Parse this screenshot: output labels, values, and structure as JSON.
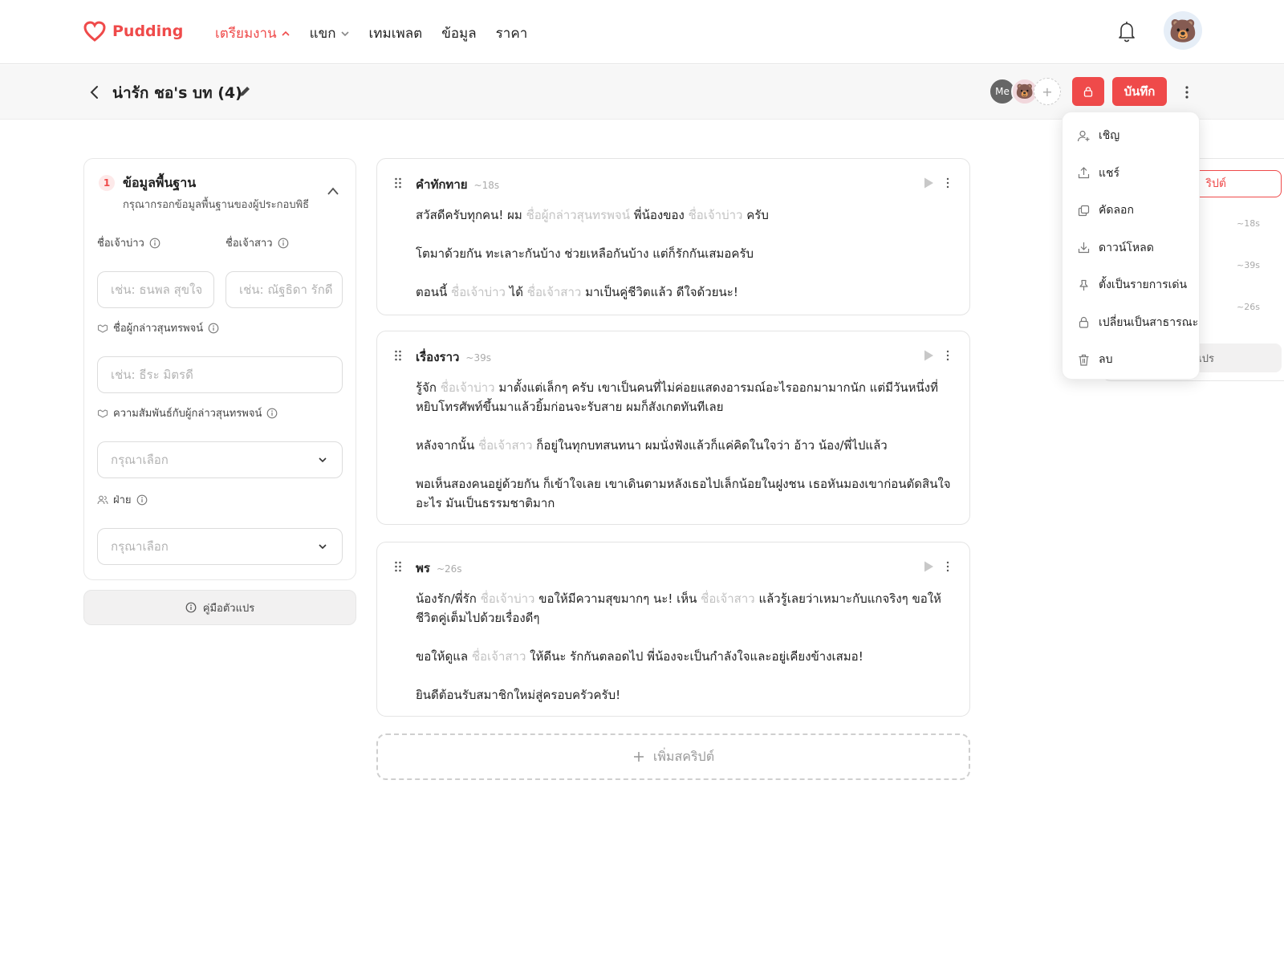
{
  "brand": {
    "name": "Pudding",
    "color": "#ef4a4a"
  },
  "nav": {
    "items": [
      {
        "label": "เตรียมงาน",
        "active": true,
        "caret": "up"
      },
      {
        "label": "แขก",
        "active": false,
        "caret": "down"
      },
      {
        "label": "เทมเพลต",
        "active": false,
        "caret": ""
      },
      {
        "label": "ข้อมูล",
        "active": false,
        "caret": ""
      },
      {
        "label": "ราคา",
        "active": false,
        "caret": ""
      }
    ],
    "icons": {
      "bell": "bell-icon",
      "avatar": "bear-avatar"
    }
  },
  "subheader": {
    "title": "น่ารัก ชอ's บท (4)",
    "collaborators": [
      {
        "label": "Me"
      },
      {
        "label": "🐻"
      },
      {
        "label": "+"
      }
    ],
    "save_label": "บันทึก"
  },
  "basic_info": {
    "step": "1",
    "title": "ข้อมูลพื้นฐาน",
    "subtitle": "กรุณากรอกข้อมูลพื้นฐานของผู้ประกอบพิธี",
    "groom_label": "ชื่อเจ้าบ่าว",
    "bride_label": "ชื่อเจ้าสาว",
    "groom_placeholder": "เช่น: ธนพล สุขใจ",
    "bride_placeholder": "เช่น: ณัฐธิดา รักดี",
    "speaker_label": "ชื่อผู้กล่าวสุนทรพจน์",
    "speaker_placeholder": "เช่น: ธีระ มิตรดี",
    "relation_label": "ความสัมพันธ์กับผู้กล่าวสุนทรพจน์",
    "relation_value": "กรุณาเลือก",
    "side_label": "ฝ่าย",
    "side_value": "กรุณาเลือก",
    "guide_label": "คู่มือตัวแปร"
  },
  "scripts": [
    {
      "title": "คำทักทาย",
      "duration": "~18s",
      "paragraphs": [
        [
          "สวัสดีครับทุกคน! ผม ",
          {
            "ph": "ชื่อผู้กล่าวสุนทรพจน์"
          },
          " พี่น้องของ ",
          {
            "ph": "ชื่อเจ้าบ่าว"
          },
          " ครับ"
        ],
        [
          "โตมาด้วยกัน ทะเลาะกันบ้าง ช่วยเหลือกันบ้าง แต่ก็รักกันเสมอครับ"
        ],
        [
          "ตอนนี้ ",
          {
            "ph": "ชื่อเจ้าบ่าว"
          },
          " ได้ ",
          {
            "ph": "ชื่อเจ้าสาว"
          },
          " มาเป็นคู่ชีวิตแล้ว ดีใจด้วยนะ!"
        ]
      ]
    },
    {
      "title": "เรื่องราว",
      "duration": "~39s",
      "paragraphs": [
        [
          "รู้จัก ",
          {
            "ph": "ชื่อเจ้าบ่าว"
          },
          " มาตั้งแต่เล็กๆ ครับ เขาเป็นคนที่ไม่ค่อยแสดงอารมณ์อะไรออกมามากนัก แต่มีวันหนึ่งที่หยิบโทรศัพท์ขึ้นมาแล้วยิ้มก่อนจะรับสาย ผมก็สังเกตทันทีเลย"
        ],
        [
          "หลังจากนั้น ",
          {
            "ph": "ชื่อเจ้าสาว"
          },
          " ก็อยู่ในทุกบทสนทนา ผมนั่งฟังแล้วก็แค่คิดในใจว่า อ้าว น้อง/พี่ไปแล้ว"
        ],
        [
          "พอเห็นสองคนอยู่ด้วยกัน ก็เข้าใจเลย เขาเดินตามหลังเธอไปเล็กน้อยในฝูงชน เธอหันมองเขาก่อนตัดสินใจอะไร มันเป็นธรรมชาติมาก"
        ]
      ]
    },
    {
      "title": "พร",
      "duration": "~26s",
      "paragraphs": [
        [
          "น้องรัก/พี่รัก ",
          {
            "ph": "ชื่อเจ้าบ่าว"
          },
          " ขอให้มีความสุขมากๆ นะ! เห็น ",
          {
            "ph": "ชื่อเจ้าสาว"
          },
          " แล้วรู้เลยว่าเหมาะกับแกจริงๆ ขอให้ชีวิตคู่เต็มไปด้วยเรื่องดีๆ"
        ],
        [
          "ขอให้ดูแล ",
          {
            "ph": "ชื่อเจ้าสาว"
          },
          " ให้ดีนะ รักกันตลอดไป พี่น้องจะเป็นกำลังใจและอยู่เคียงข้างเสมอ!"
        ],
        [
          "ยินดีต้อนรับสมาชิกใหม่สู่ครอบครัวครับ!"
        ]
      ]
    }
  ],
  "add_script_label": "เพิ่มสคริปต์",
  "right_panel": {
    "button_label": "ริปต์",
    "durations": [
      "~18s",
      "~39s",
      "~26s"
    ],
    "bottom_label": "แปร"
  },
  "menu": {
    "items": [
      {
        "label": "เชิญ",
        "icon": "invite-icon"
      },
      {
        "label": "แชร์",
        "icon": "share-icon"
      },
      {
        "label": "คัดลอก",
        "icon": "copy-icon"
      },
      {
        "label": "ดาวน์โหลด",
        "icon": "download-icon"
      },
      {
        "label": "ตั้งเป็นรายการเด่น",
        "icon": "pin-icon"
      },
      {
        "label": "เปลี่ยนเป็นสาธารณะ",
        "icon": "lock-icon"
      },
      {
        "label": "ลบ",
        "icon": "trash-icon"
      }
    ]
  }
}
